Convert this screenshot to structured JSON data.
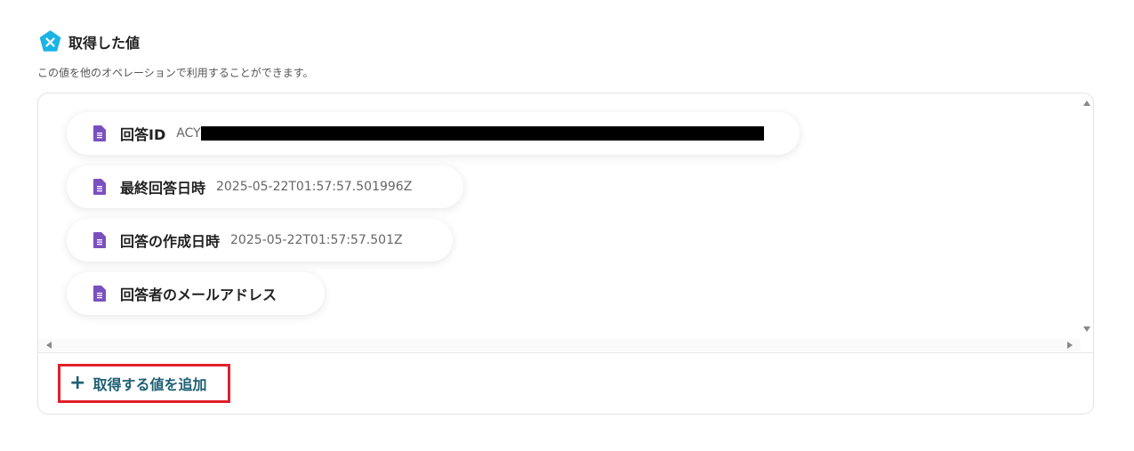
{
  "header": {
    "title": "取得した値",
    "description": "この値を他のオペレーションで利用することができます。",
    "logo_icon": "x-pentagon-icon",
    "accent_color": "#1ab3e6"
  },
  "items": [
    {
      "label": "回答ID",
      "value": "ACY",
      "icon": "form-document-icon",
      "redacted": true
    },
    {
      "label": "最終回答日時",
      "value": "2025-05-22T01:57:57.501996Z",
      "icon": "form-document-icon"
    },
    {
      "label": "回答の作成日時",
      "value": "2025-05-22T01:57:57.501Z",
      "icon": "form-document-icon"
    },
    {
      "label": "回答者のメールアドレス",
      "value": "",
      "icon": "form-document-icon"
    }
  ],
  "add_button": {
    "label": "取得する値を追加",
    "icon": "plus-icon",
    "highlight_color": "#e0202a",
    "text_color": "#1d5f73"
  },
  "icon_color": "#7b4fc0"
}
